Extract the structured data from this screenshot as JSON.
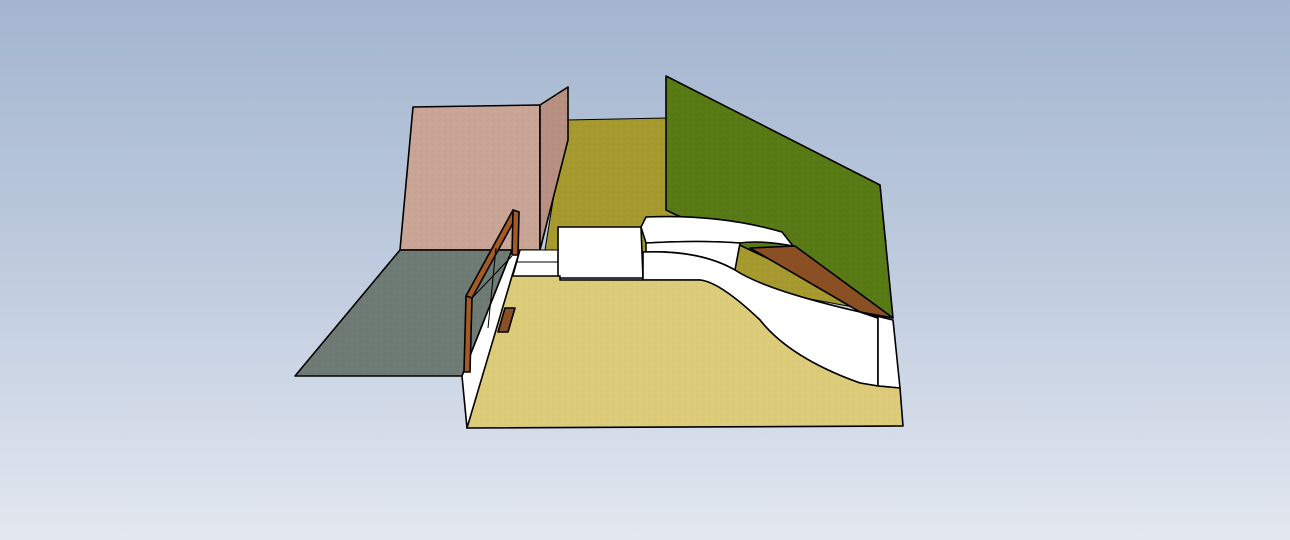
{
  "viewport": {
    "background_top": "#a3b5cf",
    "background_bottom": "#e3e8f0"
  },
  "model": {
    "colors": {
      "pink_wall": "#c9a596",
      "pink_wall_side": "#b89082",
      "grass_far": "#a69a2e",
      "green_fence": "#587a14",
      "grey_paving": "#6e7b74",
      "sand_ground": "#dccc79",
      "white_structure": "#ffffff",
      "timber_rail": "#a55a23",
      "timber_deck": "#8a4f22"
    },
    "icons": [
      "3d-model-canvas"
    ]
  }
}
